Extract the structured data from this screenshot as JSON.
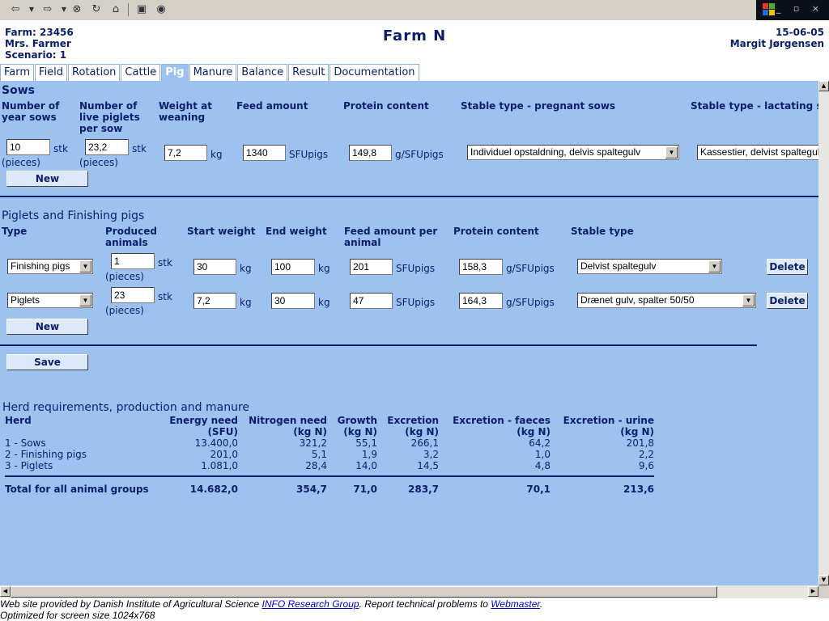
{
  "header": {
    "farm": "Farm: 23456",
    "owner": "Mrs. Farmer",
    "scenario": "Scenario: 1",
    "title": "Farm N",
    "date": "15-06-05",
    "user": "Margit Jørgensen"
  },
  "tabs": [
    {
      "label": "Farm"
    },
    {
      "label": "Field"
    },
    {
      "label": "Rotation"
    },
    {
      "label": "Cattle"
    },
    {
      "label": "Pig",
      "active": true
    },
    {
      "label": "Manure"
    },
    {
      "label": "Balance"
    },
    {
      "label": "Result"
    },
    {
      "label": "Documentation"
    }
  ],
  "sows": {
    "title": "Sows",
    "col_year_sows": "Number of year sows",
    "col_live_piglets": "Number of live piglets per sow",
    "col_weight_weaning": "Weight at weaning",
    "col_feed": "Feed amount",
    "col_protein": "Protein content",
    "col_stable_pregnant": "Stable type - pregnant sows",
    "col_stable_lactating": "Stable type - lactating sows",
    "year_sows": "10",
    "live_piglets": "23,2",
    "weight_weaning": "7,2",
    "feed": "1340",
    "protein": "149,8",
    "stable_pregnant": "Individuel opstaldning, delvis spaltegulv",
    "stable_lactating": "Kassestier, delvist spaltegulv",
    "unit_stk": "stk",
    "unit_pieces": "(pieces)",
    "unit_kg": "kg",
    "unit_sfu": "SFUpigs",
    "unit_g_sfu": "g/SFUpigs",
    "new_label": "New"
  },
  "piglets": {
    "title": "Piglets and Finishing pigs",
    "col_type": "Type",
    "col_produced": "Produced animals",
    "col_start": "Start weight",
    "col_end": "End weight",
    "col_feed": "Feed amount per animal",
    "col_protein": "Protein content",
    "col_stable": "Stable type",
    "rows": [
      {
        "type": "Finishing pigs",
        "produced": "1",
        "start": "30",
        "end": "100",
        "feed": "201",
        "protein": "158,3",
        "stable": "Delvist spaltegulv",
        "delete": "Delete"
      },
      {
        "type": "Piglets",
        "produced": "23",
        "start": "7,2",
        "end": "30",
        "feed": "47",
        "protein": "164,3",
        "stable": "Drænet gulv, spalter 50/50",
        "delete": "Delete"
      }
    ],
    "new_label": "New",
    "save_label": "Save"
  },
  "herd": {
    "title": "Herd requirements, production and manure",
    "headers": {
      "herd": "Herd",
      "energy1": "Energy need",
      "energy2": "(SFU)",
      "nitrogen1": "Nitrogen need",
      "nitrogen2": "(kg N)",
      "growth1": "Growth",
      "growth2": "(kg N)",
      "excretion1": "Excretion",
      "excretion2": "(kg N)",
      "faeces1": "Excretion - faeces",
      "faeces2": "(kg N)",
      "urine1": "Excretion - urine",
      "urine2": "(kg N)"
    },
    "rows": [
      {
        "herd": "1 - Sows",
        "energy": "13.400,0",
        "nitrogen": "321,2",
        "growth": "55,1",
        "excretion": "266,1",
        "faeces": "64,2",
        "urine": "201,8"
      },
      {
        "herd": "2 - Finishing pigs",
        "energy": "201,0",
        "nitrogen": "5,1",
        "growth": "1,9",
        "excretion": "3,2",
        "faeces": "1,0",
        "urine": "2,2"
      },
      {
        "herd": "3 - Piglets",
        "energy": "1.081,0",
        "nitrogen": "28,4",
        "growth": "14,0",
        "excretion": "14,5",
        "faeces": "4,8",
        "urine": "9,6"
      }
    ],
    "total": {
      "herd": "Total for all animal groups",
      "energy": "14.682,0",
      "nitrogen": "354,7",
      "growth": "71,0",
      "excretion": "283,7",
      "faeces": "70,1",
      "urine": "213,6"
    }
  },
  "footer": {
    "line1_a": "Web site provided by Danish Institute of Agricultural Science ",
    "link_info": "INFO Research Group",
    "line1_b": ". Report technical problems to ",
    "link_webmaster": "Webmaster",
    "line1_c": ".",
    "line2": "Optimized for screen size 1024x768"
  }
}
